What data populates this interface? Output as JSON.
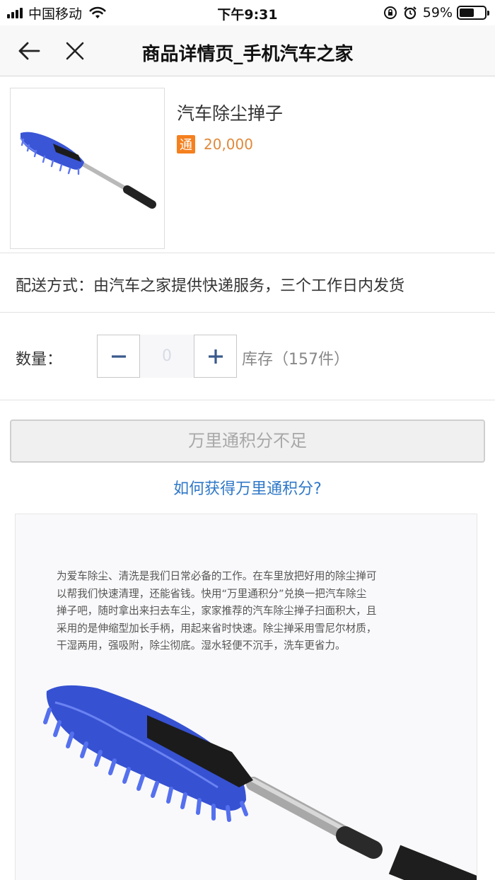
{
  "status_bar": {
    "carrier": "中国移动",
    "time": "下午9:31",
    "battery_percent": "59%",
    "battery_level": 0.59
  },
  "nav": {
    "title": "商品详情页_手机汽车之家",
    "back_icon": "back-arrow-icon",
    "close_icon": "close-icon"
  },
  "product": {
    "name": "汽车除尘掸子",
    "badge": "通",
    "price": "20,000",
    "image_icon": "car-duster-image"
  },
  "delivery": {
    "text": "配送方式：由汽车之家提供快递服务，三个工作日内发货"
  },
  "quantity": {
    "label": "数量：",
    "value": "0",
    "stock": "库存（157件）"
  },
  "actions": {
    "submit_label": "万里通积分不足",
    "help_link": "如何获得万里通积分?"
  },
  "description": {
    "lines": [
      "为爱车除尘、清洗是我们日常必备的工作。在车里放把好用的除尘掸可",
      "以帮我们快速清理，还能省钱。快用“万里通积分”兑换一把汽车除尘",
      "掸子吧，随时拿出来扫去车尘，家家推荐的汽车除尘掸子扫面积大，且",
      "采用的是伸缩型加长手柄，用起来省时快速。除尘掸采用雪尼尔材质，",
      "干湿两用，强吸附，除尘彻底。湿水轻便不沉手，洗车更省力。"
    ]
  },
  "colors": {
    "accent_orange": "#f5801f",
    "price_orange": "#e0893a",
    "link_blue": "#2f78c8",
    "duster_blue": "#3a55d6"
  }
}
